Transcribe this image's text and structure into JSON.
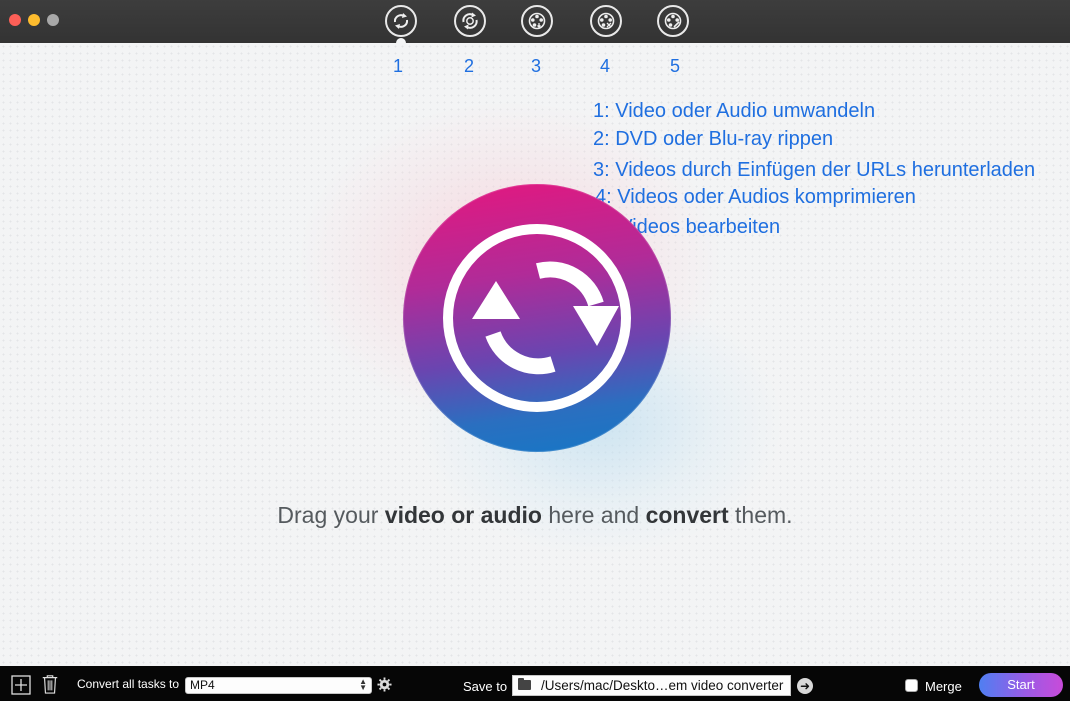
{
  "titlebar": {
    "tools": [
      {
        "name": "convert-video-audio",
        "icon": "convert-icon",
        "active": true
      },
      {
        "name": "rip-dvd-bluray",
        "icon": "rip-disc-icon"
      },
      {
        "name": "download-urls",
        "icon": "download-film-icon"
      },
      {
        "name": "compress",
        "icon": "compress-film-icon"
      },
      {
        "name": "edit",
        "icon": "edit-film-icon"
      }
    ]
  },
  "annotations": {
    "numbers": [
      "1",
      "2",
      "3",
      "4",
      "5"
    ],
    "legend": [
      "1: Video oder Audio umwandeln",
      "2: DVD oder Blu-ray rippen",
      "3: Videos durch Einfügen der URLs herunterladen",
      "4: Videos oder Audios komprimieren",
      "5: Videos bearbeiten"
    ]
  },
  "main": {
    "drop_icon": "convert-arrows-icon",
    "drag_text": {
      "part1": "Drag your ",
      "bold1": "video or audio",
      "part2": " here and ",
      "bold2": "convert",
      "part3": " them."
    }
  },
  "bottombar": {
    "convert_all_label": "Convert all tasks to",
    "format_value": "MP4",
    "save_to_label": "Save to",
    "save_path": "/Users/mac/Deskto…em video converter",
    "merge_label": "Merge",
    "merge_checked": false,
    "start_label": "Start"
  },
  "colors": {
    "annotation_blue": "#1f6fe0",
    "circle_gradient": [
      "#e5177e",
      "#6a45b0",
      "#1478c6"
    ],
    "start_gradient": [
      "#4f7ff1",
      "#c84bd9"
    ]
  }
}
